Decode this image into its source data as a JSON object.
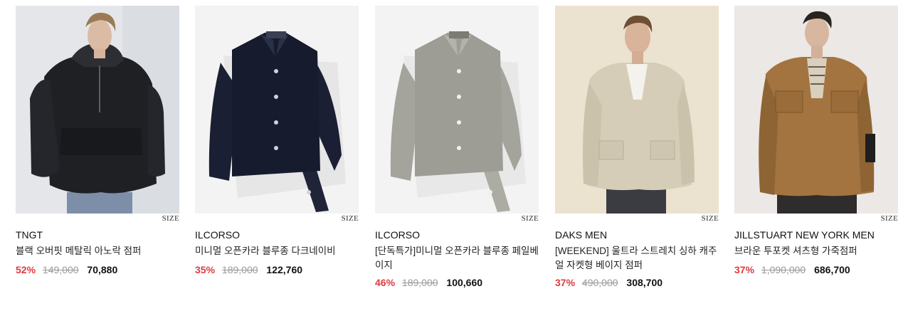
{
  "size_label": "SIZE",
  "products": [
    {
      "brand": "TNGT",
      "name": "블랙 오버핏 메탈릭 아노락 점퍼",
      "discount": "52%",
      "original_price": "149,000",
      "sale_price": "70,880"
    },
    {
      "brand": "ILCORSO",
      "name": "미니멀 오픈카라 블루종 다크네이비",
      "discount": "35%",
      "original_price": "189,000",
      "sale_price": "122,760"
    },
    {
      "brand": "ILCORSO",
      "name": "[단독특가]미니멀 오픈카라 블루종 페일베이지",
      "discount": "46%",
      "original_price": "189,000",
      "sale_price": "100,660"
    },
    {
      "brand": "DAKS MEN",
      "name": "[WEEKEND] 울트라 스트레치 싱하 캐주얼 자켓형 베이지 점퍼",
      "discount": "37%",
      "original_price": "490,000",
      "sale_price": "308,700"
    },
    {
      "brand": "JILLSTUART NEW YORK MEN",
      "name": "브라운 투포켓 셔츠형 가죽점퍼",
      "discount": "37%",
      "original_price": "1,090,000",
      "sale_price": "686,700"
    }
  ],
  "colors": {
    "discount": "#e03a3e",
    "original_price": "#9a9a9a"
  }
}
